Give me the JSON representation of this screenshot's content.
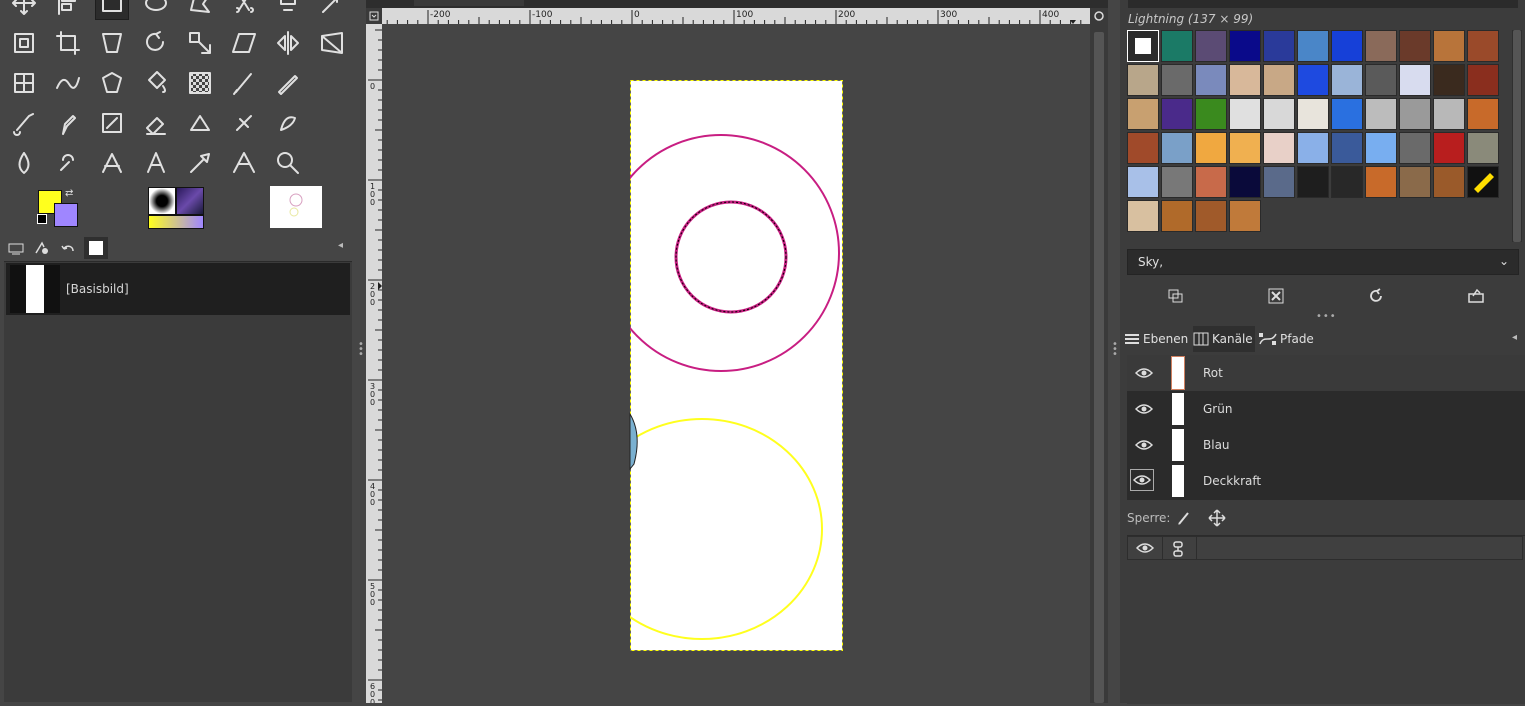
{
  "toolbox": {
    "tools": [
      "move-tool",
      "align-tool",
      "rect-select-tool",
      "ellipse-select-tool",
      "free-select-tool",
      "scissors-select-tool",
      "foreground-select-tool",
      "fuzzy-select-tool",
      "by-color-select-tool",
      "crop-tool",
      "unified-transform-tool",
      "rotate-tool",
      "scale-tool",
      "shear-tool",
      "flip-tool",
      "perspective-tool",
      "cage-transform-tool",
      "warp-transform-tool",
      "handle-transform-tool",
      "bucket-fill-tool",
      "blend-tool",
      "paintbrush-tool",
      "pencil-tool",
      "airbrush-tool",
      "ink-tool",
      "mypaint-brush-tool",
      "eraser-tool",
      "clone-tool",
      "heal-tool",
      "smudge-tool",
      "blur-tool",
      "dodge-burn-tool",
      "measure-tool",
      "text-tool",
      "color-picker-tool",
      "paths-tool",
      "zoom-tool"
    ],
    "fg_color": "#ffff1e",
    "bg_color": "#9f86ff"
  },
  "images_panel": {
    "image_name": "[Basisbild]"
  },
  "ruler": {
    "h_ticks": [
      "-200",
      "-100",
      "0",
      "100",
      "200",
      "300",
      "400"
    ],
    "v_ticks": [
      "0",
      "100",
      "200",
      "300",
      "400",
      "500",
      "600"
    ]
  },
  "patterns": {
    "header": "Lightning (137 × 99)",
    "selected": "Sky,",
    "colors": [
      "#ffffff",
      "#1b7a66",
      "#5b4b74",
      "#0a0a8a",
      "#2a3a9a",
      "#4a86c8",
      "#1640d8",
      "#8a6a5a",
      "#6a3a2a",
      "#b8743a",
      "#9a4a2a",
      "#b8a68a",
      "#6a6a6a",
      "#7a8abc",
      "#d8b89a",
      "#c8a886",
      "#1e4ae0",
      "#9ab4d8",
      "#5a5a5a",
      "#d8dcef",
      "#3a2a1e",
      "#8a2e1e",
      "#c8a070",
      "#4a2a8a",
      "#3a8a1e",
      "#e0e0e0",
      "#d8d8d8",
      "#e8e4dc",
      "#2a70e0",
      "#bcbcbc",
      "#9a9a9a",
      "#b8b8b8",
      "#c86a2a",
      "#a04a2a",
      "#7aa0c8",
      "#f0a840",
      "#f0b050",
      "#e8d0c8",
      "#8ab0e8",
      "#3a5a9a",
      "#78aef0",
      "#6a6a6a",
      "#b81e1e",
      "#8a8a7a",
      "#a8c0e8",
      "#787878",
      "#c86a4a",
      "#0a0a3a",
      "#5a6a8a",
      "#1e1e1e",
      "#282828",
      "#c86a2a",
      "#8a6a4a",
      "#9a5a2a",
      "#111111",
      "#d8c0a0",
      "#b06a2a",
      "#a05a2a",
      "#c07a3a"
    ]
  },
  "dock_tabs": {
    "layers": "Ebenen",
    "channels": "Kanäle",
    "paths": "Pfade"
  },
  "channels": [
    {
      "name": "Rot"
    },
    {
      "name": "Grün"
    },
    {
      "name": "Blau"
    },
    {
      "name": "Deckkraft"
    }
  ],
  "lock": {
    "label": "Sperre:"
  },
  "canvas": {
    "ring_color": "#c81e82",
    "circle_color": "#ffff1e"
  }
}
